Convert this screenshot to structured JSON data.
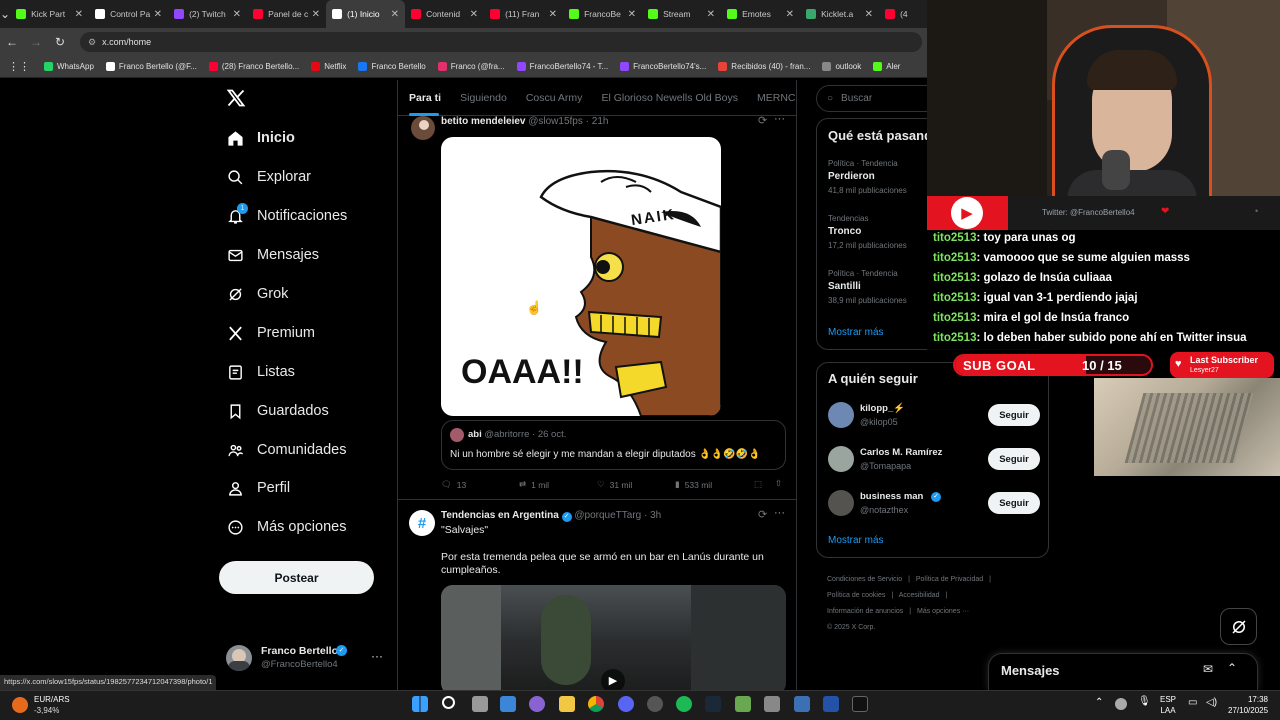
{
  "browser": {
    "tabs": [
      {
        "label": "Kick Part",
        "color": "#53fc18"
      },
      {
        "label": "Control Pa",
        "color": "#ffffff"
      },
      {
        "label": "(2) Twitch",
        "color": "#9146ff"
      },
      {
        "label": "Panel de c",
        "color": "#ff0033"
      },
      {
        "label": "(1) Inicio",
        "color": "#ffffff"
      },
      {
        "label": "Contenid",
        "color": "#ff0033"
      },
      {
        "label": "(11) Fran",
        "color": "#ff0033"
      },
      {
        "label": "FrancoBe",
        "color": "#53fc18"
      },
      {
        "label": "Stream",
        "color": "#53fc18"
      },
      {
        "label": "Emotes",
        "color": "#53fc18"
      },
      {
        "label": "Kicklet.a",
        "color": "#3aa76d"
      },
      {
        "label": "(4",
        "color": "#ff0033"
      }
    ],
    "url": "x.com/home",
    "bookmarks": [
      "WhatsApp",
      "Franco Bertello (@F...",
      "(28) Franco Bertello...",
      "Netflix",
      "Franco Bertello",
      "Franco (@fra...",
      "FrancoBertello74 - T...",
      "FrancoBertello74's...",
      "Recibidos (40) - fran...",
      "outlook",
      "Aler"
    ],
    "status_url": "https://x.com/slow15fps/status/1982577234712047398/photo/1"
  },
  "nav": {
    "items": [
      "Inicio",
      "Explorar",
      "Notificaciones",
      "Mensajes",
      "Grok",
      "Premium",
      "Listas",
      "Guardados",
      "Comunidades",
      "Perfil",
      "Más opciones"
    ],
    "notif_badge": "1",
    "post_label": "Postear",
    "user_name": "Franco Bertello",
    "user_handle": "@FrancoBertello4"
  },
  "feed": {
    "tabs": [
      "Para ti",
      "Siguiendo",
      "Coscu Army",
      "El Glorioso Newells Old Boys",
      "MERNC"
    ],
    "tweet1": {
      "name": "betito mendeleiev",
      "handle": "@slow15fps",
      "time": "· 21h",
      "image_text": "OAAA!!",
      "cap_text": "NAIK",
      "quote_name": "abi",
      "quote_handle": "@abritorre",
      "quote_time": "· 26 oct.",
      "quote_text": "Ni un hombre sé elegir y me mandan a elegir diputados 👌👌🤣🤣👌",
      "replies": "13",
      "reposts": "1 mil",
      "likes": "31 mil",
      "views": "533 mil"
    },
    "tweet2": {
      "name": "Tendencias en Argentina",
      "handle": "@porqueTTarg",
      "time": "· 3h",
      "quote": "\"Salvajes\"",
      "text": "Por esta tremenda pelea que se armó en un bar en Lanús durante un cumpleaños."
    }
  },
  "right": {
    "search_placeholder": "Buscar",
    "trends_title": "Qué está pasando",
    "trends": [
      {
        "meta": "Política · Tendencia",
        "name": "Perdieron",
        "count": "41,8 mil publicaciones"
      },
      {
        "meta": "Tendencias",
        "name": "Tronco",
        "count": "17,2 mil publicaciones"
      },
      {
        "meta": "Política · Tendencia",
        "name": "Santilli",
        "count": "38,9 mil publicaciones"
      }
    ],
    "show_more": "Mostrar más",
    "follow_title": "A quién seguir",
    "follows": [
      {
        "name": "kilopp_⚡",
        "handle": "@kilop05",
        "btn": "Seguir"
      },
      {
        "name": "Carlos M. Ramírez",
        "handle": "@Tomapapa",
        "btn": "Seguir"
      },
      {
        "name": "business man",
        "handle": "@notazthex",
        "btn": "Seguir"
      }
    ],
    "footer": [
      "Condiciones de Servicio",
      "Política de Privacidad",
      "Política de cookies",
      "Accesibilidad",
      "Información de anuncios",
      "Más opciones ···",
      "© 2025 X Corp."
    ],
    "messages_label": "Mensajes"
  },
  "stream": {
    "twitter_handle": "Twitter: @FrancoBertello4",
    "chat": [
      {
        "user": "tito2513",
        "msg": ": toy para unas og"
      },
      {
        "user": "tito2513",
        "msg": ": vamoooo que se sume alguien masss"
      },
      {
        "user": "tito2513",
        "msg": ": golazo de Insúa culiaaa"
      },
      {
        "user": "tito2513",
        "msg": ": igual van 3-1 perdiendo jajaj"
      },
      {
        "user": "tito2513",
        "msg": ": mira el gol de Insúa franco"
      },
      {
        "user": "tito2513",
        "msg": ": lo deben haber subido pone ahí en Twitter insua"
      }
    ],
    "sub_goal_label": "SUB GOAL",
    "sub_goal_value": "10 / 15",
    "sub_goal_progress": 0.67,
    "last_sub_title": "Last Subscriber",
    "last_sub_name": "Lesyer27"
  },
  "taskbar": {
    "currency": "EUR/ARS",
    "change": "-3,94%",
    "lang1": "ESP",
    "lang2": "LAA",
    "time": "17:38",
    "date": "27/10/2025"
  }
}
